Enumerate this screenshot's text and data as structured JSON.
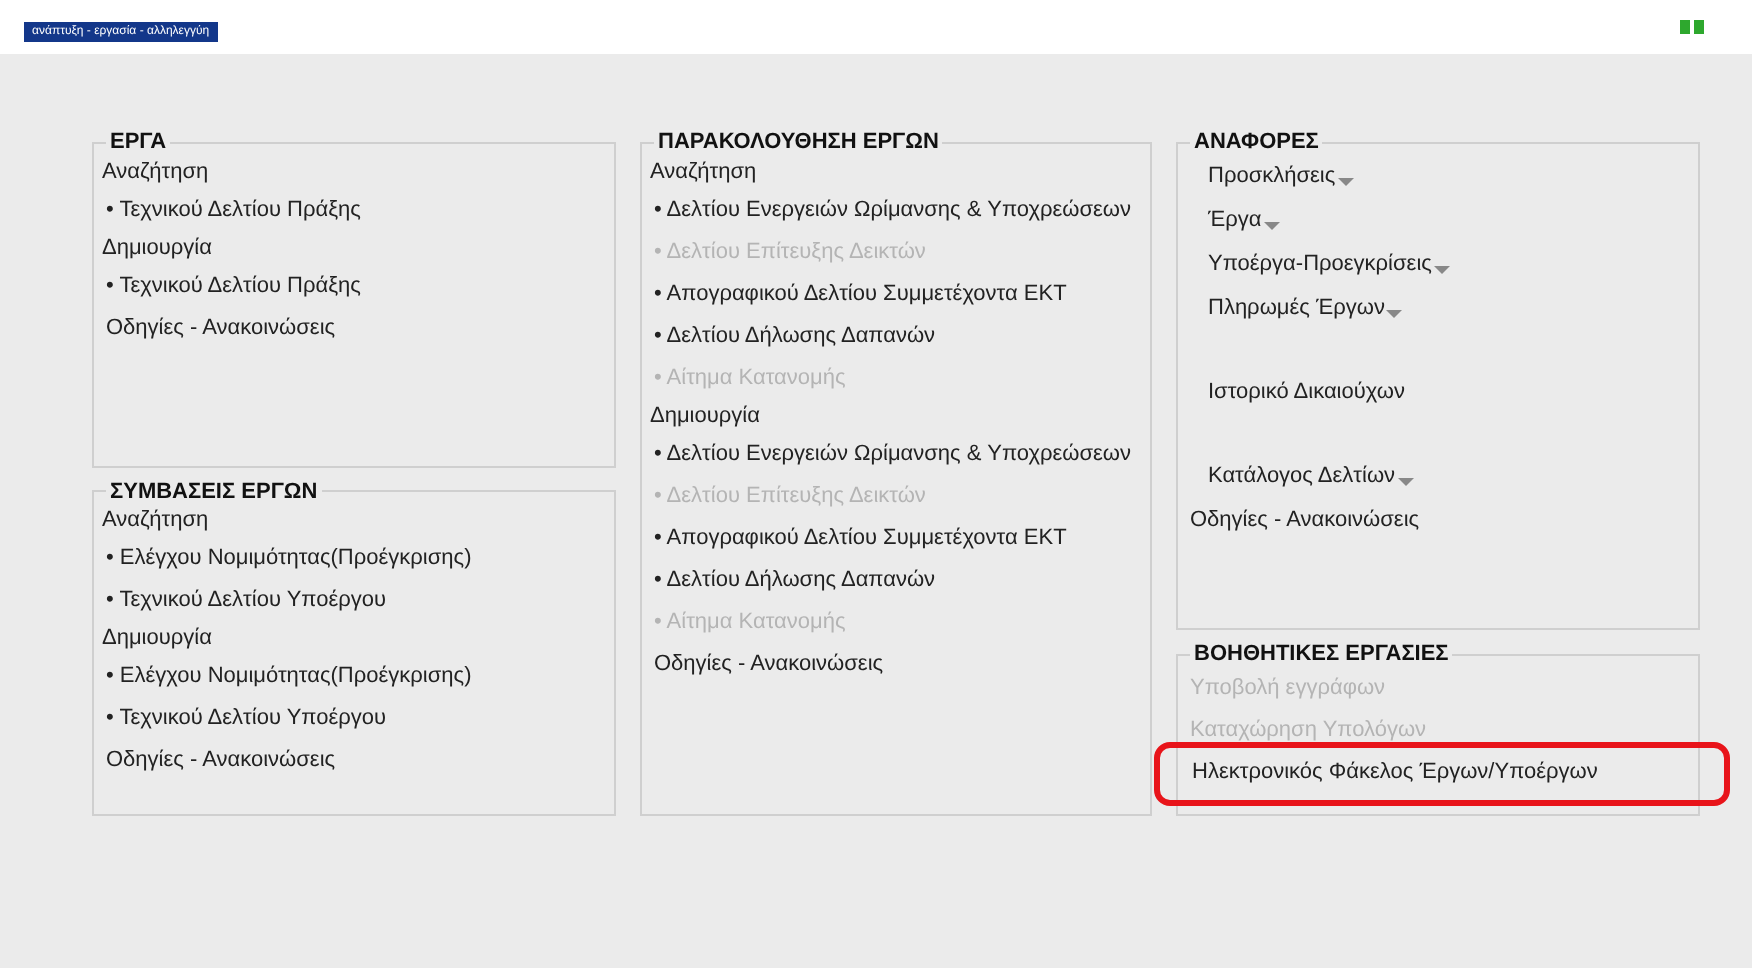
{
  "header": {
    "logo": "ανάπτυξη - εργασία - αλληλεγγύη"
  },
  "columns": [
    {
      "panels": [
        {
          "title": "ΕΡΓΑ",
          "items": [
            {
              "kind": "label",
              "text": "Αναζήτηση",
              "disabled": false
            },
            {
              "kind": "link",
              "text": "• Τεχνικού Δελτίου Πράξης",
              "disabled": false
            },
            {
              "kind": "label",
              "text": "Δημιουργία",
              "disabled": false
            },
            {
              "kind": "link",
              "text": "• Τεχνικού Δελτίου Πράξης",
              "disabled": false
            },
            {
              "kind": "notice",
              "text": "Οδηγίες - Ανακοινώσεις",
              "disabled": false
            }
          ]
        },
        {
          "title": "ΣΥΜΒΑΣΕΙΣ ΕΡΓΩΝ",
          "items": [
            {
              "kind": "label",
              "text": "Αναζήτηση",
              "disabled": false
            },
            {
              "kind": "link",
              "text": "• Ελέγχου Νομιμότητας(Προέγκρισης)",
              "disabled": false
            },
            {
              "kind": "link",
              "text": "• Τεχνικού Δελτίου Υποέργου",
              "disabled": false
            },
            {
              "kind": "label",
              "text": "Δημιουργία",
              "disabled": false
            },
            {
              "kind": "link",
              "text": "• Ελέγχου Νομιμότητας(Προέγκρισης)",
              "disabled": false
            },
            {
              "kind": "link",
              "text": "• Τεχνικού Δελτίου Υποέργου",
              "disabled": false
            },
            {
              "kind": "notice",
              "text": "Οδηγίες - Ανακοινώσεις",
              "disabled": false
            }
          ]
        }
      ]
    },
    {
      "panels": [
        {
          "title": "ΠΑΡΑΚΟΛΟΥΘΗΣΗ ΕΡΓΩΝ",
          "items": [
            {
              "kind": "label",
              "text": "Αναζήτηση",
              "disabled": false
            },
            {
              "kind": "link",
              "text": "• Δελτίου Ενεργειών Ωρίμανσης & Υποχρεώσεων",
              "disabled": false
            },
            {
              "kind": "link",
              "text": "• Δελτίου Επίτευξης Δεικτών",
              "disabled": true
            },
            {
              "kind": "link",
              "text": "• Απογραφικού Δελτίου Συμμετέχοντα ΕΚΤ",
              "disabled": false
            },
            {
              "kind": "link",
              "text": "• Δελτίου Δήλωσης Δαπανών",
              "disabled": false
            },
            {
              "kind": "link",
              "text": "• Αίτημα Κατανομής",
              "disabled": true
            },
            {
              "kind": "label",
              "text": "Δημιουργία",
              "disabled": false
            },
            {
              "kind": "link",
              "text": "• Δελτίου Ενεργειών Ωρίμανσης & Υποχρεώσεων",
              "disabled": false
            },
            {
              "kind": "link",
              "text": "• Δελτίου Επίτευξης Δεικτών",
              "disabled": true
            },
            {
              "kind": "link",
              "text": "• Απογραφικού Δελτίου Συμμετέχοντα ΕΚΤ",
              "disabled": false
            },
            {
              "kind": "link",
              "text": "• Δελτίου Δήλωσης Δαπανών",
              "disabled": false
            },
            {
              "kind": "link",
              "text": "• Αίτημα Κατανομής",
              "disabled": true
            },
            {
              "kind": "notice",
              "text": "Οδηγίες - Ανακοινώσεις",
              "disabled": false
            }
          ]
        }
      ]
    },
    {
      "panels": [
        {
          "title": "ΑΝΑΦΟΡΕΣ",
          "items": [
            {
              "kind": "report",
              "text": "Προσκλήσεις",
              "dropdown": true,
              "separated": false,
              "disabled": false
            },
            {
              "kind": "report",
              "text": "Έργα",
              "dropdown": true,
              "separated": false,
              "disabled": false
            },
            {
              "kind": "report",
              "text": "Υποέργα-Προεγκρίσεις",
              "dropdown": true,
              "separated": false,
              "disabled": false
            },
            {
              "kind": "report",
              "text": "Πληρωμές Έργων",
              "dropdown": true,
              "separated": false,
              "disabled": false
            },
            {
              "kind": "report",
              "text": "Ιστορικό Δικαιούχων",
              "dropdown": false,
              "separated": true,
              "disabled": false
            },
            {
              "kind": "report",
              "text": "Κατάλογος Δελτίων",
              "dropdown": true,
              "separated": true,
              "disabled": false
            },
            {
              "kind": "notice",
              "text": "Οδηγίες - Ανακοινώσεις",
              "disabled": false
            }
          ]
        },
        {
          "title": "ΒΟΗΘΗΤΙΚΕΣ ΕΡΓΑΣΙΕΣ",
          "items": [
            {
              "kind": "notice",
              "text": "Υποβολή εγγράφων",
              "disabled": true
            },
            {
              "kind": "notice",
              "text": "Καταχώρηση Υπολόγων",
              "disabled": true
            },
            {
              "kind": "notice",
              "text": "Ηλεκτρονικός Φάκελος Έργων/Υποέργων",
              "disabled": false,
              "highlighted": true
            }
          ]
        }
      ]
    }
  ]
}
